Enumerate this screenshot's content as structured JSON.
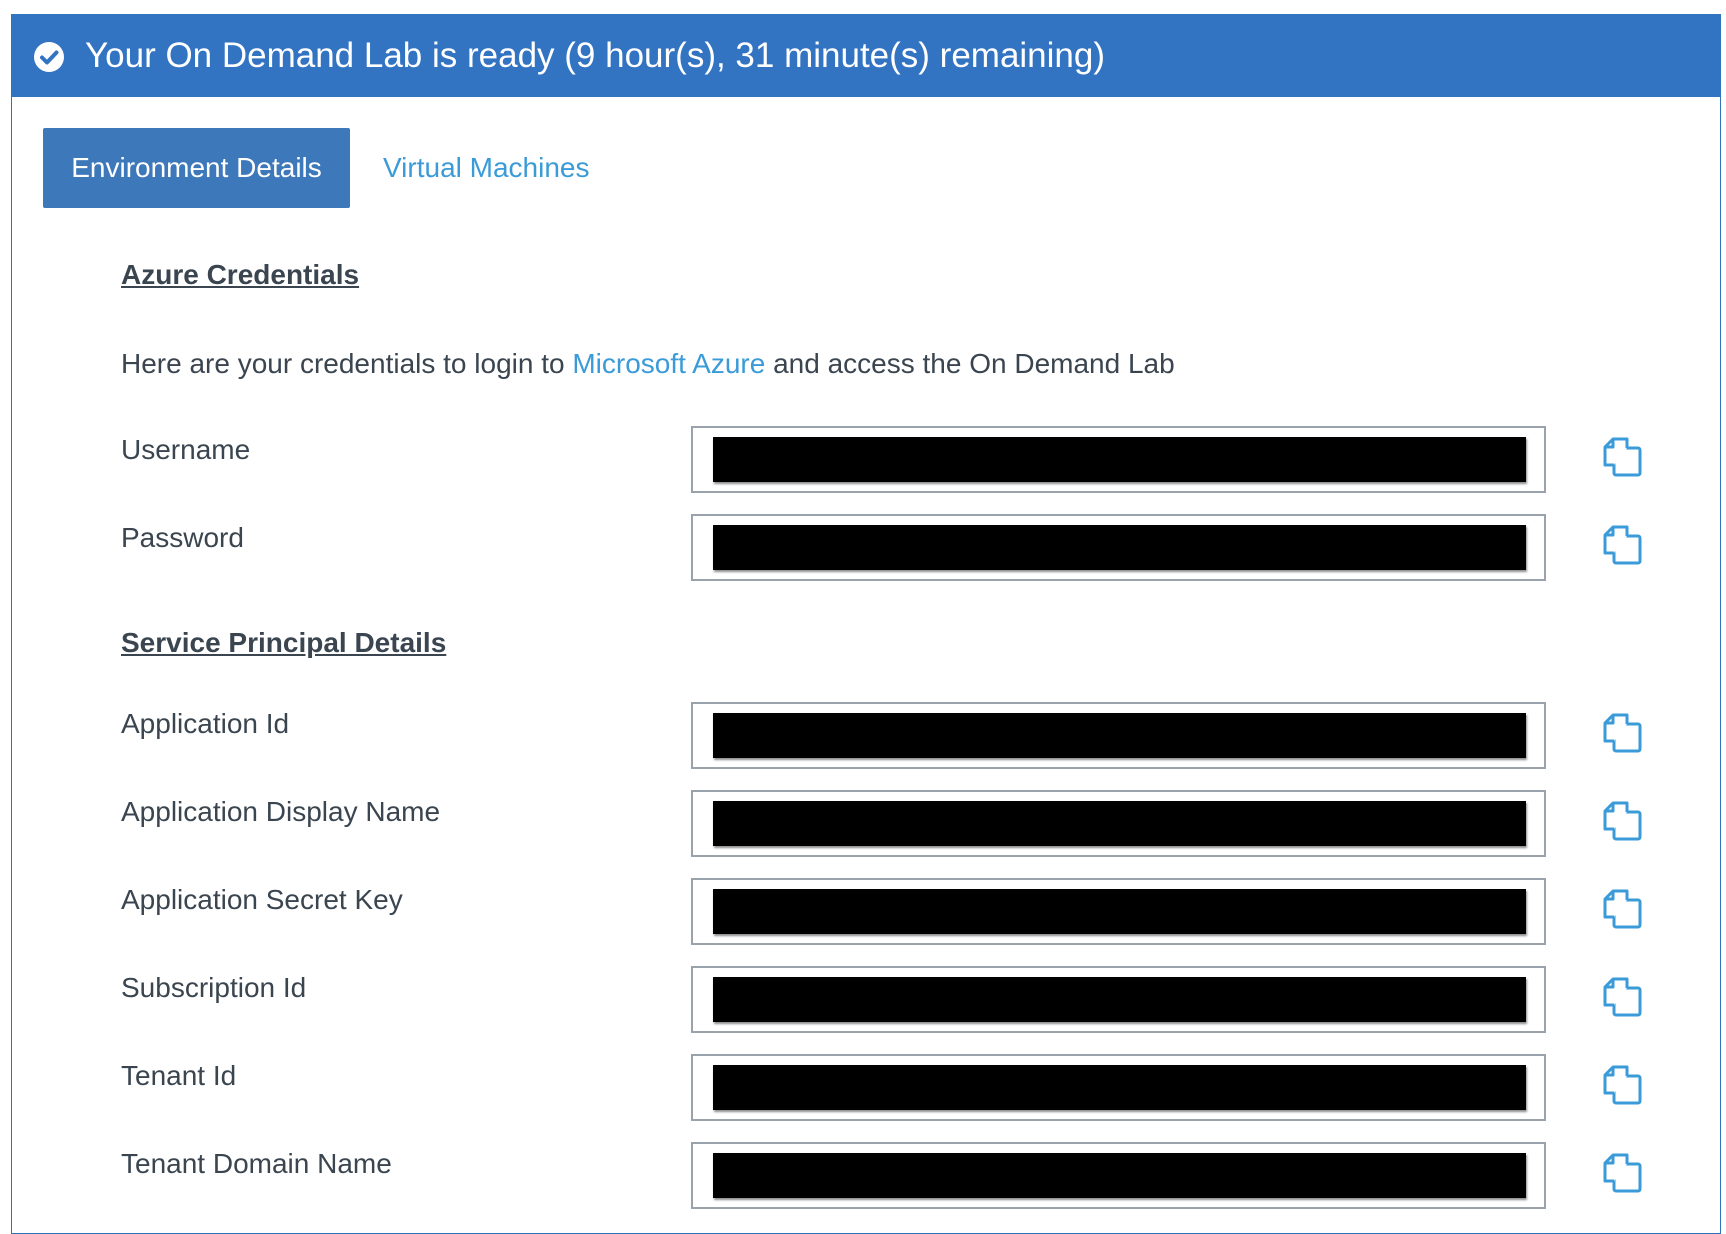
{
  "banner": {
    "text": "Your On Demand Lab is ready (9 hour(s), 31 minute(s) remaining)",
    "color": "#3273c2",
    "icon": "check-circle-icon"
  },
  "tabs": [
    {
      "label": "Environment Details",
      "active": true
    },
    {
      "label": "Virtual Machines",
      "active": false
    }
  ],
  "azure": {
    "heading": "Azure Credentials",
    "intro_before": "Here are your credentials to login to ",
    "intro_link": "Microsoft Azure",
    "intro_after": " and access the On Demand Lab",
    "fields": [
      {
        "label": "Username",
        "value": ""
      },
      {
        "label": "Password",
        "value": ""
      }
    ]
  },
  "service_principal": {
    "heading": "Service Principal Details",
    "fields": [
      {
        "label": "Application Id",
        "value": ""
      },
      {
        "label": "Application Display Name",
        "value": ""
      },
      {
        "label": "Application Secret Key",
        "value": ""
      },
      {
        "label": "Subscription Id",
        "value": ""
      },
      {
        "label": "Tenant Id",
        "value": ""
      },
      {
        "label": "Tenant Domain Name",
        "value": ""
      }
    ]
  },
  "copy_icon": "copy-icon",
  "link_color": "#3a9bd8"
}
